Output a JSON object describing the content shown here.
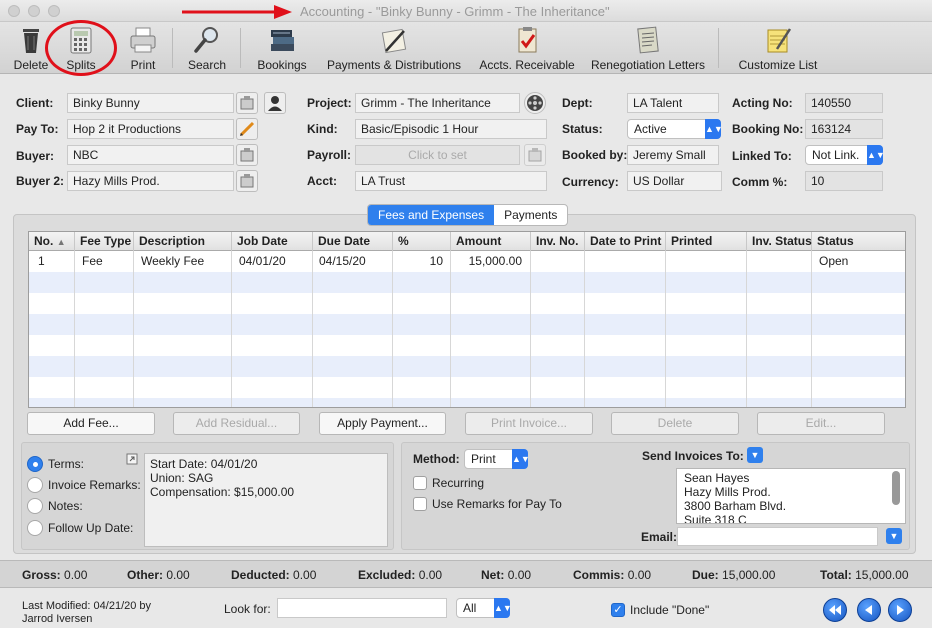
{
  "window": {
    "title": "Accounting - \"Binky Bunny - Grimm - The Inheritance\""
  },
  "toolbar": {
    "items": [
      {
        "label": "Delete",
        "icon": "trash-icon"
      },
      {
        "label": "Splits",
        "icon": "calculator-icon"
      },
      {
        "label": "Print",
        "icon": "printer-icon"
      },
      {
        "label": "Search",
        "icon": "magnifier-icon"
      },
      {
        "label": "Bookings",
        "icon": "books-icon"
      },
      {
        "label": "Payments & Distributions",
        "icon": "pen-paper-icon"
      },
      {
        "label": "Accts. Receivable",
        "icon": "clipboard-check-icon"
      },
      {
        "label": "Renegotiation Letters",
        "icon": "document-icon"
      },
      {
        "label": "Customize List",
        "icon": "notepad-pencil-icon"
      }
    ]
  },
  "form": {
    "client_label": "Client:",
    "client": "Binky Bunny",
    "payto_label": "Pay To:",
    "payto": "Hop 2 it Productions",
    "buyer_label": "Buyer:",
    "buyer": "NBC",
    "buyer2_label": "Buyer 2:",
    "buyer2": "Hazy Mills Prod.",
    "project_label": "Project:",
    "project": "Grimm - The Inheritance",
    "kind_label": "Kind:",
    "kind": "Basic/Episodic 1 Hour",
    "payroll_label": "Payroll:",
    "payroll_placeholder": "Click to set",
    "acct_label": "Acct:",
    "acct": "LA Trust",
    "dept_label": "Dept:",
    "dept": "LA Talent",
    "status_label": "Status:",
    "status": "Active",
    "bookedby_label": "Booked by:",
    "bookedby": "Jeremy Small",
    "currency_label": "Currency:",
    "currency": "US Dollar",
    "actingno_label": "Acting No:",
    "actingno": "140550",
    "bookingno_label": "Booking No:",
    "bookingno": "163124",
    "linkedto_label": "Linked To:",
    "linkedto": "Not Link.",
    "comm_label": "Comm %:",
    "comm": "10"
  },
  "tabs": {
    "fees": "Fees and Expenses",
    "payments": "Payments"
  },
  "grid": {
    "columns": [
      "No.",
      "Fee Type",
      "Description",
      "Job Date",
      "Due Date",
      "%",
      "Amount",
      "Inv. No.",
      "Date to Print",
      "Printed",
      "Inv. Status",
      "Status"
    ],
    "rows": [
      {
        "no": "1",
        "fee_type": "Fee",
        "description": "Weekly Fee",
        "job_date": "04/01/20",
        "due_date": "04/15/20",
        "pct": "10",
        "amount": "15,000.00",
        "inv_no": "",
        "date_to_print": "",
        "printed": "",
        "inv_status": "",
        "status": "Open"
      }
    ]
  },
  "buttons": {
    "add_fee": "Add Fee...",
    "add_residual": "Add Residual...",
    "apply_payment": "Apply Payment...",
    "print_invoice": "Print Invoice...",
    "delete": "Delete",
    "edit": "Edit..."
  },
  "notes": {
    "terms": "Terms:",
    "invoice_remarks": "Invoice Remarks:",
    "notes": "Notes:",
    "follow_up": "Follow Up Date:",
    "line1": "Start Date: 04/01/20",
    "line2": "Union: SAG",
    "line3": "Compensation: $15,000.00"
  },
  "invoice": {
    "method_label": "Method:",
    "method": "Print",
    "recurring": "Recurring",
    "use_remarks": "Use Remarks for Pay To",
    "send_to_label": "Send Invoices To:",
    "addr1": "Sean Hayes",
    "addr2": "Hazy Mills Prod.",
    "addr3": "3800 Barham Blvd.",
    "addr4": "Suite 318 C",
    "email_label": "Email:"
  },
  "totals": {
    "gross_label": "Gross:",
    "gross": "0.00",
    "other_label": "Other:",
    "other": "0.00",
    "deducted_label": "Deducted:",
    "deducted": "0.00",
    "excluded_label": "Excluded:",
    "excluded": "0.00",
    "net_label": "Net:",
    "net": "0.00",
    "commis_label": "Commis:",
    "commis": "0.00",
    "due_label": "Due:",
    "due": "15,000.00",
    "total_label": "Total:",
    "total": "15,000.00"
  },
  "footer": {
    "modified1": "Last Modified: 04/21/20 by",
    "modified2": "Jarrod Iversen",
    "look_for": "Look for:",
    "filter": "All",
    "include_done": "Include \"Done\""
  },
  "colors": {
    "accent": "#2f80ed",
    "annotation": "#e0101a"
  }
}
